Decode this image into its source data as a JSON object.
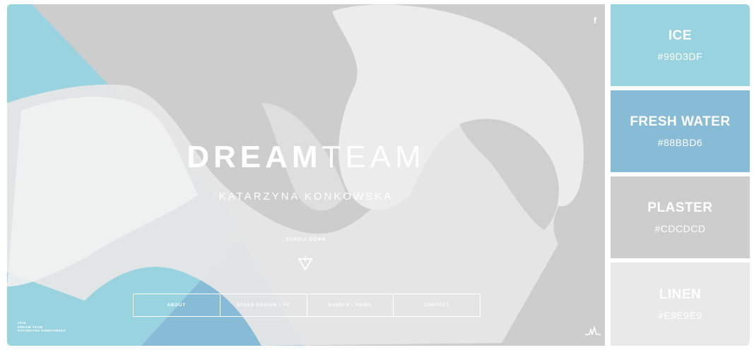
{
  "hero": {
    "facebook_icon_glyph": "f",
    "title_bold": "DREAM",
    "title_light": "TEAM",
    "subtitle": "KATARZYNA KONKOWSKA",
    "scroll_label": "SCROLL DOWN",
    "nav": [
      "ABOUT",
      "STAGE DESIGN • TV",
      "EVENTS • FAIRS",
      "CONTACT"
    ],
    "footnote": [
      "2016",
      "DREAM TEAM",
      "KATARZYNA KONKOWSKA"
    ]
  },
  "palette": [
    {
      "name": "ICE",
      "hex": "#99D3DF",
      "color": "#99d3df",
      "text_color": "#ffffff"
    },
    {
      "name": "FRESH WATER",
      "hex": "#88BBD6",
      "color": "#88bbd6",
      "text_color": "#ffffff"
    },
    {
      "name": "PLASTER",
      "hex": "#CDCDCD",
      "color": "#cdcdcd",
      "text_color": "#ffffff"
    },
    {
      "name": "LINEN",
      "hex": "#E9E9E9",
      "color": "#e9e9e9",
      "text_color": "#ffffff"
    }
  ]
}
